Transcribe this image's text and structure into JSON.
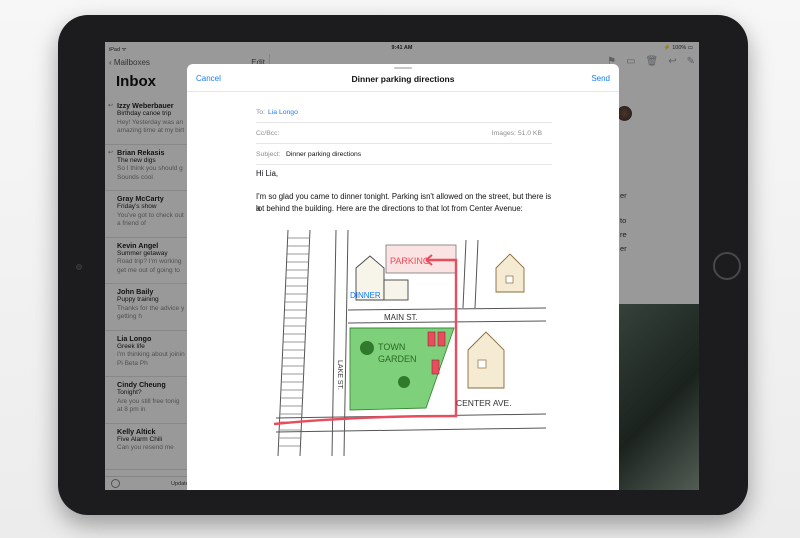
{
  "status_bar": {
    "carrier": "iPad ᯤ",
    "time": "9:41 AM",
    "battery": "⚡ 100% ▭"
  },
  "sidebar": {
    "back_label": "Mailboxes",
    "edit_label": "Edit",
    "title": "Inbox",
    "updated_text": "Update",
    "messages": [
      {
        "from": "Izzy Weberbauer",
        "subject": "Birthday canoe trip",
        "preview_1": "Hey! Yesterday was an",
        "preview_2": "amazing time at my birt"
      },
      {
        "from": "Brian Rekasis",
        "subject": "The new digs",
        "preview_1": "So I think you should g",
        "preview_2": "Sounds cool"
      },
      {
        "from": "Gray McCarty",
        "subject": "Friday's show",
        "preview_1": "You've got to check out",
        "preview_2": "a friend of"
      },
      {
        "from": "Kevin Angel",
        "subject": "Summer getaway",
        "preview_1": "Road trip? I'm working",
        "preview_2": "get me out of going to"
      },
      {
        "from": "John Baily",
        "subject": "Puppy training",
        "preview_1": "Thanks for the advice y",
        "preview_2": "getting h"
      },
      {
        "from": "Lia Longo",
        "subject": "Greek life",
        "preview_1": "I'm thinking about joinin",
        "preview_2": "Pi Beta Ph"
      },
      {
        "from": "Cindy Cheung",
        "subject": "Tonight?",
        "preview_1": "Are you still free tonig",
        "preview_2": "at 8 pm in"
      },
      {
        "from": "Kelly Altick",
        "subject": "Five Alarm Chili",
        "preview_1": "Can you resend me",
        "preview_2": ""
      }
    ]
  },
  "detail": {
    "fragments": [
      "er",
      "to",
      "re",
      "er"
    ]
  },
  "compose": {
    "cancel_label": "Cancel",
    "title": "Dinner parking directions",
    "send_label": "Send",
    "to_label": "To:",
    "to_value": "Lia Longo",
    "ccbcc_label": "Cc/Bcc:",
    "images_size": "Images: 51.0 KB",
    "subject_label": "Subject:",
    "subject_value": "Dinner parking directions",
    "greeting": "Hi Lia,",
    "body_line_1": "I'm so glad you came to dinner tonight. Parking isn't allowed on the street, but there is a",
    "body_line_2": "lot behind the building. Here are the directions to that lot from Center Avenue:",
    "map": {
      "parking_label": "PARKING",
      "dinner_label": "DINNER",
      "main_st_label": "MAIN ST.",
      "lake_st_label": "LAKE ST.",
      "town_label": "TOWN",
      "garden_label": "GARDEN",
      "center_ave_label": "CENTER AVE."
    }
  },
  "colors": {
    "accent": "#147efb",
    "route": "#e94c5c",
    "garden": "#7ed07a"
  }
}
